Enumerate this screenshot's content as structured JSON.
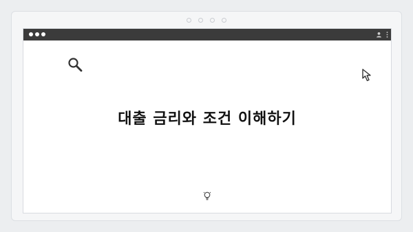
{
  "page": {
    "heading": "대출 금리와 조건 이해하기"
  },
  "icons": {
    "window_controls": "traffic-light-dots",
    "profile": "user-icon",
    "menu": "kebab-menu-icon",
    "search": "search-icon",
    "cursor": "cursor-arrow-icon",
    "hint": "lightbulb-icon"
  },
  "colors": {
    "titlebar": "#3b3b3b",
    "background": "#eceef0",
    "page": "#ffffff",
    "text": "#111111"
  }
}
